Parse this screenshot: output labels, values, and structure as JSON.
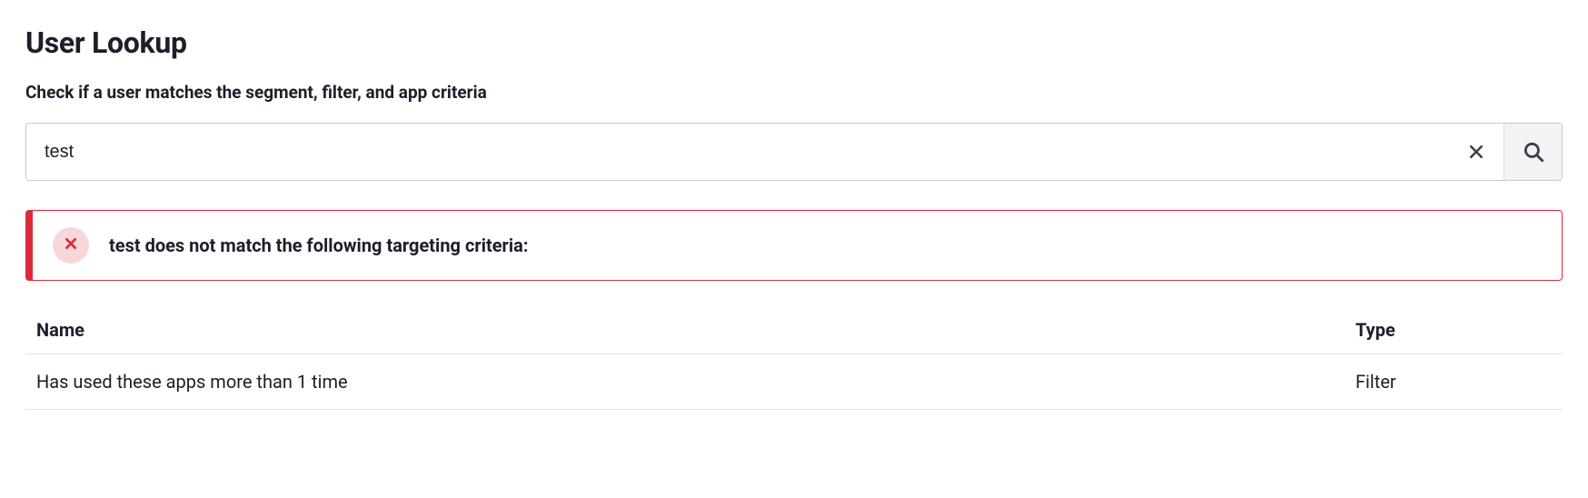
{
  "header": {
    "title": "User Lookup",
    "subtitle": "Check if a user matches the segment, filter, and app criteria"
  },
  "search": {
    "value": "test",
    "placeholder": ""
  },
  "alert": {
    "message": "test does not match the following targeting criteria:"
  },
  "table": {
    "columns": {
      "name": "Name",
      "type": "Type"
    },
    "rows": [
      {
        "name": "Has used these apps more than 1 time",
        "type": "Filter"
      }
    ]
  }
}
